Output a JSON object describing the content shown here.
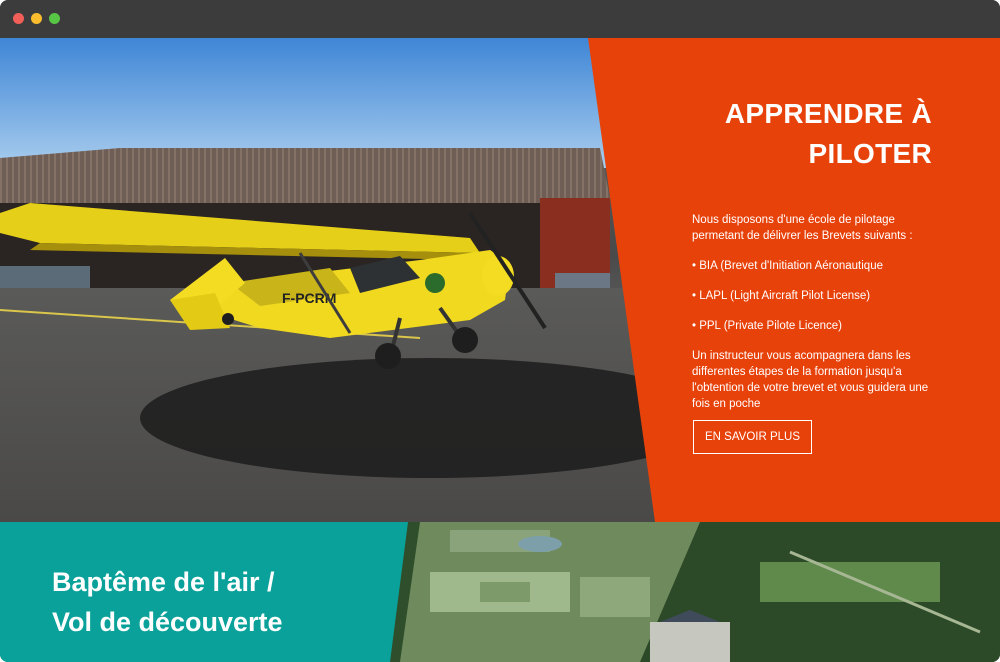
{
  "colors": {
    "accent_orange": "#e8420b",
    "teal": "#0aa19a",
    "titlebar": "#3c3c3c"
  },
  "window": {
    "controls": [
      "close-dot",
      "minimize-dot",
      "maximize-dot"
    ]
  },
  "hero": {
    "plane_registration": "F-PCRM",
    "panel": {
      "title_line1": "APPRENDRE À",
      "title_line2": "PILOTER",
      "intro": "Nous disposons d'une école de pilotage permetant de délivrer les Brevets suivants :",
      "bullets": [
        "• BIA (Brevet d'Initiation Aéronautique",
        "• LAPL (Light Aircraft Pilot License)",
        "• PPL (Private Pilote Licence)"
      ],
      "outro": "Un instructeur vous acompagnera dans les differentes étapes de la formation jusqu'a l'obtention de votre brevet et vous guidera une fois en poche",
      "cta_label": "EN SAVOIR PLUS"
    }
  },
  "bottom": {
    "title_line1": "Baptême de l'air /",
    "title_line2": "Vol de découverte"
  }
}
